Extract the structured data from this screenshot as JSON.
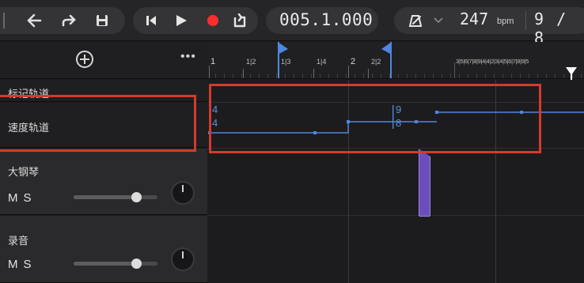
{
  "toolbar": {
    "undo": "undo-icon",
    "redo": "redo-icon",
    "save": "save-icon",
    "skip_back": "skip-to-start-icon",
    "play": "play-icon",
    "record": "record-icon",
    "loop": "loop-icon",
    "position": "005.1.000",
    "metronome": "metronome-icon",
    "tempo_dropdown": "chevron-down-icon",
    "bpm": "247",
    "bpm_unit": "bpm",
    "time_signature": "9 / 8"
  },
  "colors": {
    "record": "#ff2d2d",
    "tempo_line": "#4f86df",
    "annotation": "#d43a2c",
    "clip": "#6a4fbb",
    "playhead": "#ffffff"
  },
  "header": {
    "add_track": "add-track-icon",
    "more": "•••"
  },
  "ruler": {
    "labels": [
      "1",
      "1|2",
      "1|3",
      "1|4",
      "2",
      "2|2"
    ],
    "dense_labels": "3|5|6|7|8|9|4|4|2|3|4|5|6|7|8|9|5"
  },
  "tracks": [
    {
      "name": "标记轨道"
    },
    {
      "name": "速度轨道"
    },
    {
      "name": "大钢琴",
      "mute": "M",
      "solo": "S",
      "volume": 0.75
    },
    {
      "name": "录音",
      "mute": "M",
      "solo": "S",
      "volume": 0.75
    }
  ],
  "tempo_track": {
    "meter_top": "4",
    "meter_bottom": "4",
    "meter_change_top": "9",
    "meter_change_bottom": "8"
  }
}
